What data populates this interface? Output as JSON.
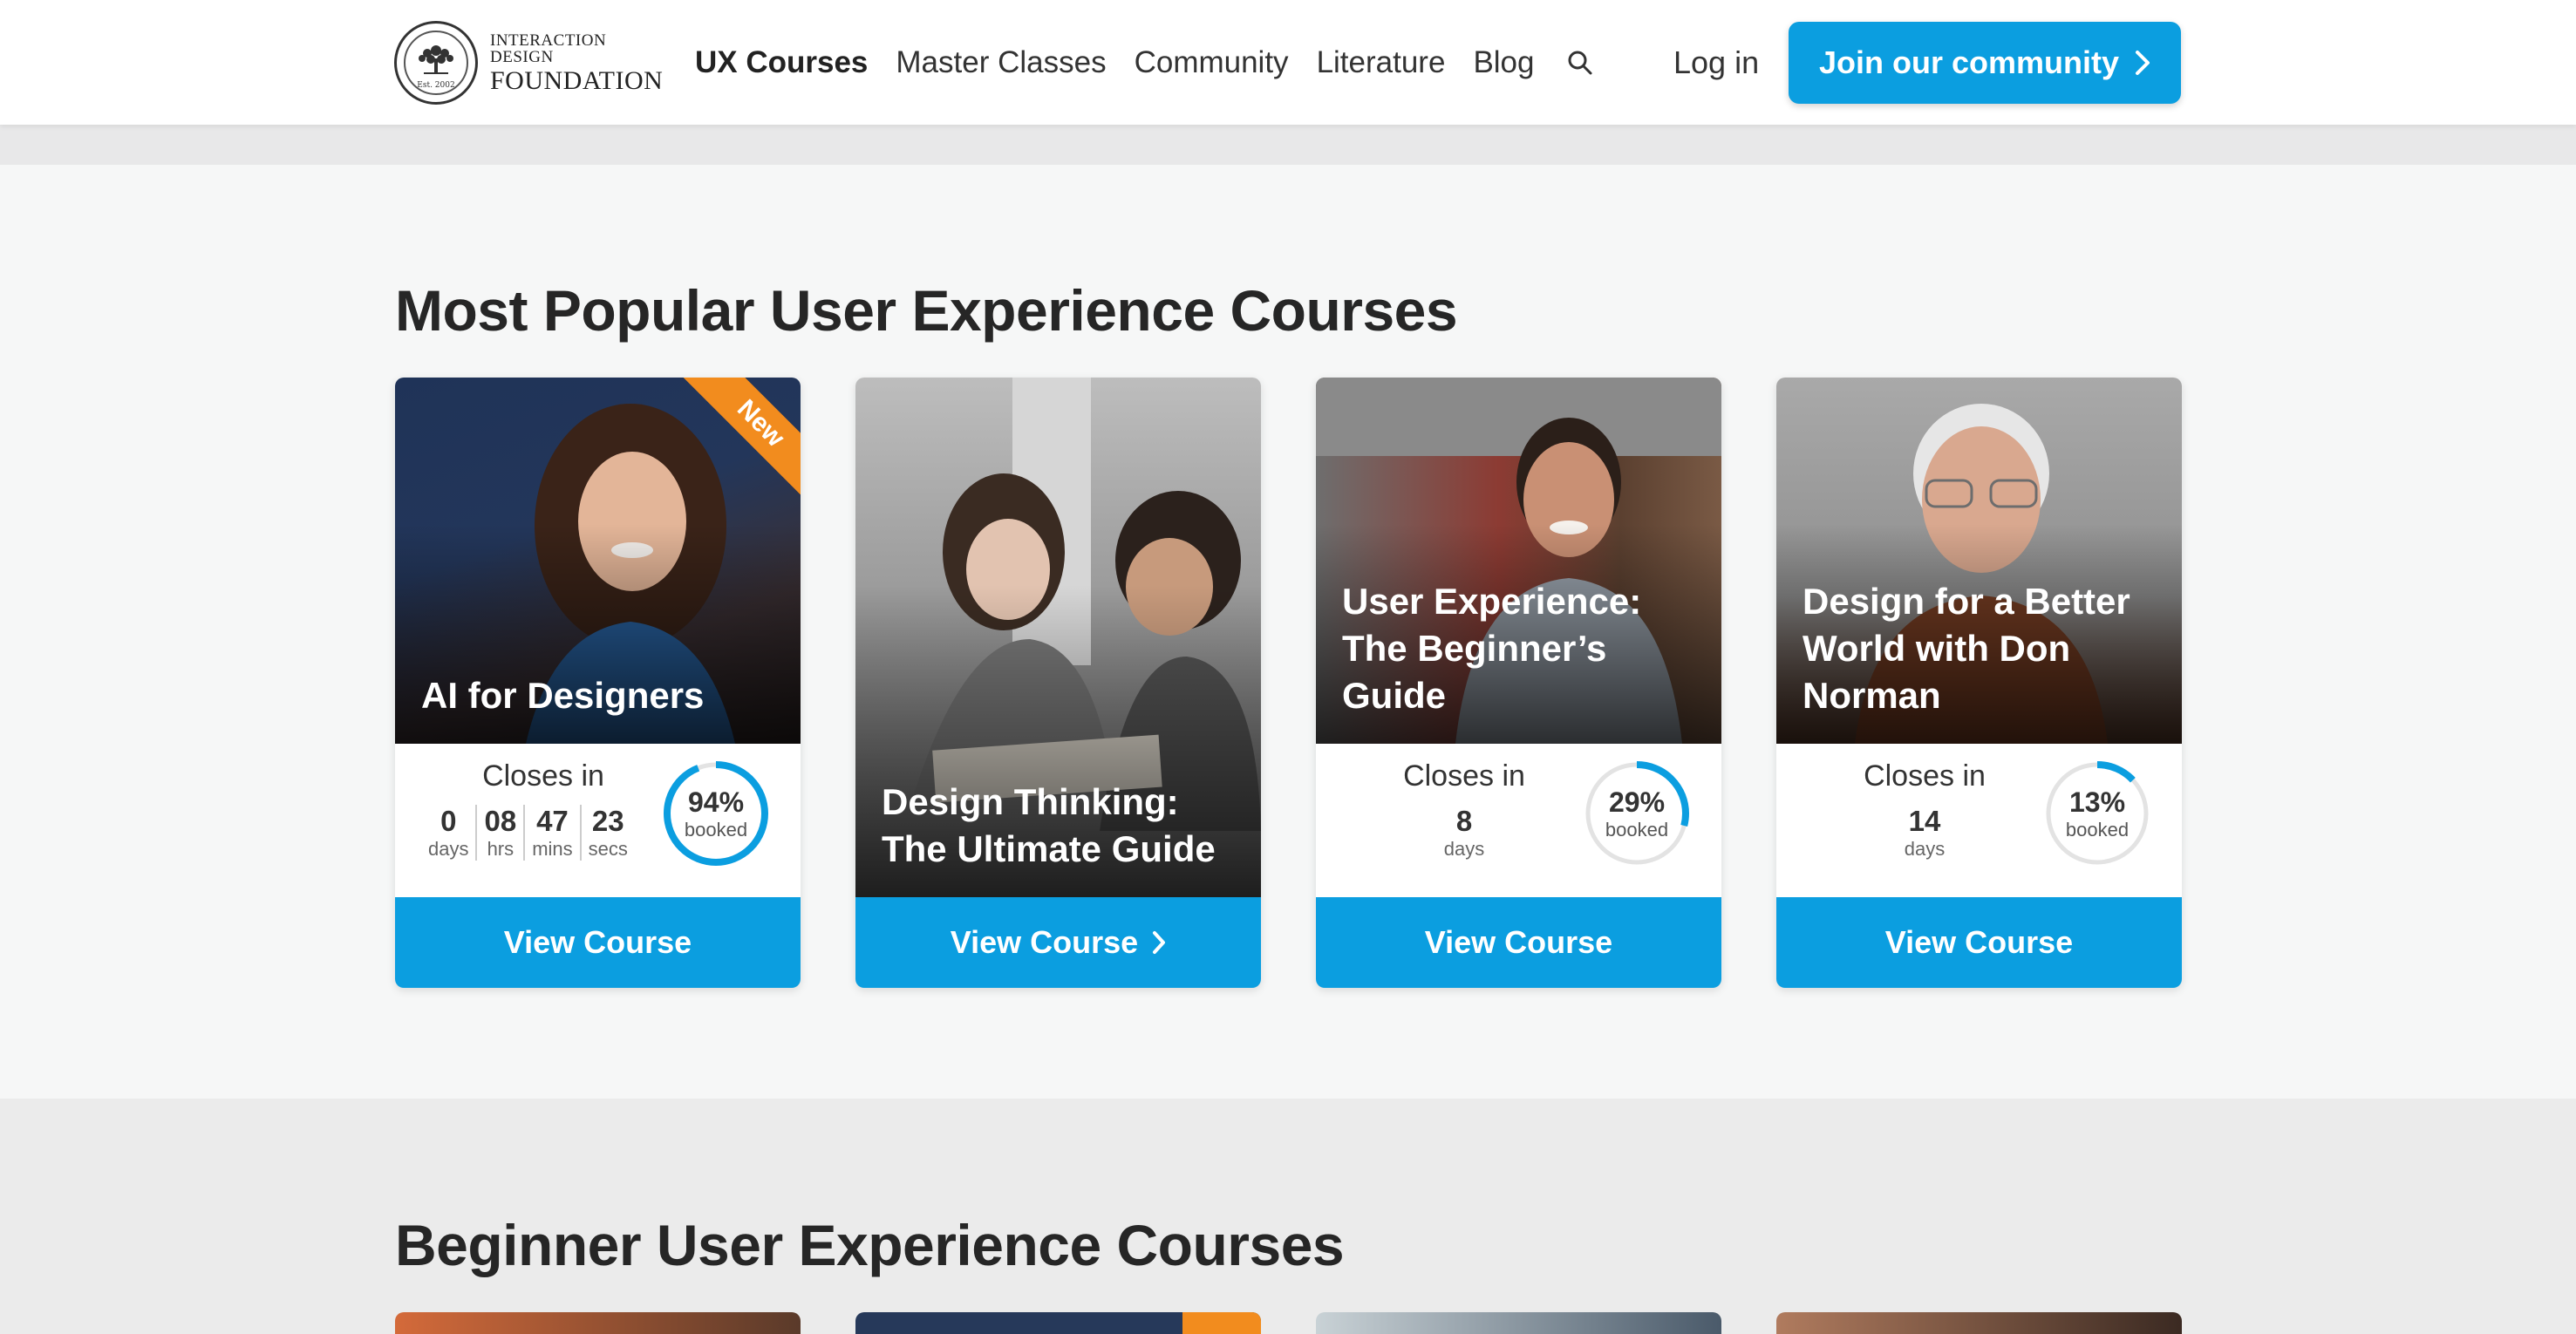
{
  "header": {
    "logo": {
      "line1": "INTERACTION DESIGN",
      "line2": "FOUNDATION",
      "est": "Est. 2002"
    },
    "nav": [
      {
        "label": "UX Courses",
        "active": true
      },
      {
        "label": "Master Classes"
      },
      {
        "label": "Community"
      },
      {
        "label": "Literature"
      },
      {
        "label": "Blog"
      }
    ],
    "login_label": "Log in",
    "join_label": "Join our community"
  },
  "sections": {
    "popular_title": "Most Popular User Experience Courses",
    "beginner_title": "Beginner User Experience Courses"
  },
  "courses": [
    {
      "title": "AI for Designers",
      "badge": "New",
      "closes_label": "Closes in",
      "countdown": [
        {
          "value": "0",
          "unit": "days"
        },
        {
          "value": "08",
          "unit": "hrs"
        },
        {
          "value": "47",
          "unit": "mins"
        },
        {
          "value": "23",
          "unit": "secs"
        }
      ],
      "booked_percent": 94,
      "booked_text": "94%",
      "booked_label": "booked",
      "button_label": "View Course"
    },
    {
      "title": "Design Thinking: The Ultimate Guide",
      "button_label": "View Course"
    },
    {
      "title": "User Experience: The Beginner’s Guide",
      "closes_label": "Closes in",
      "countdown": [
        {
          "value": "8",
          "unit": "days"
        }
      ],
      "booked_percent": 29,
      "booked_text": "29%",
      "booked_label": "booked",
      "button_label": "View Course"
    },
    {
      "title": "Design for a Better World with Don Norman",
      "closes_label": "Closes in",
      "countdown": [
        {
          "value": "14",
          "unit": "days"
        }
      ],
      "booked_percent": 13,
      "booked_text": "13%",
      "booked_label": "booked",
      "button_label": "View Course"
    }
  ],
  "colors": {
    "primary": "#0b9ee0",
    "badge": "#f28c1e",
    "ring_track": "#e3e3e3"
  },
  "icons": [
    "search-icon",
    "chevron-right-icon",
    "tree-logo-icon"
  ]
}
